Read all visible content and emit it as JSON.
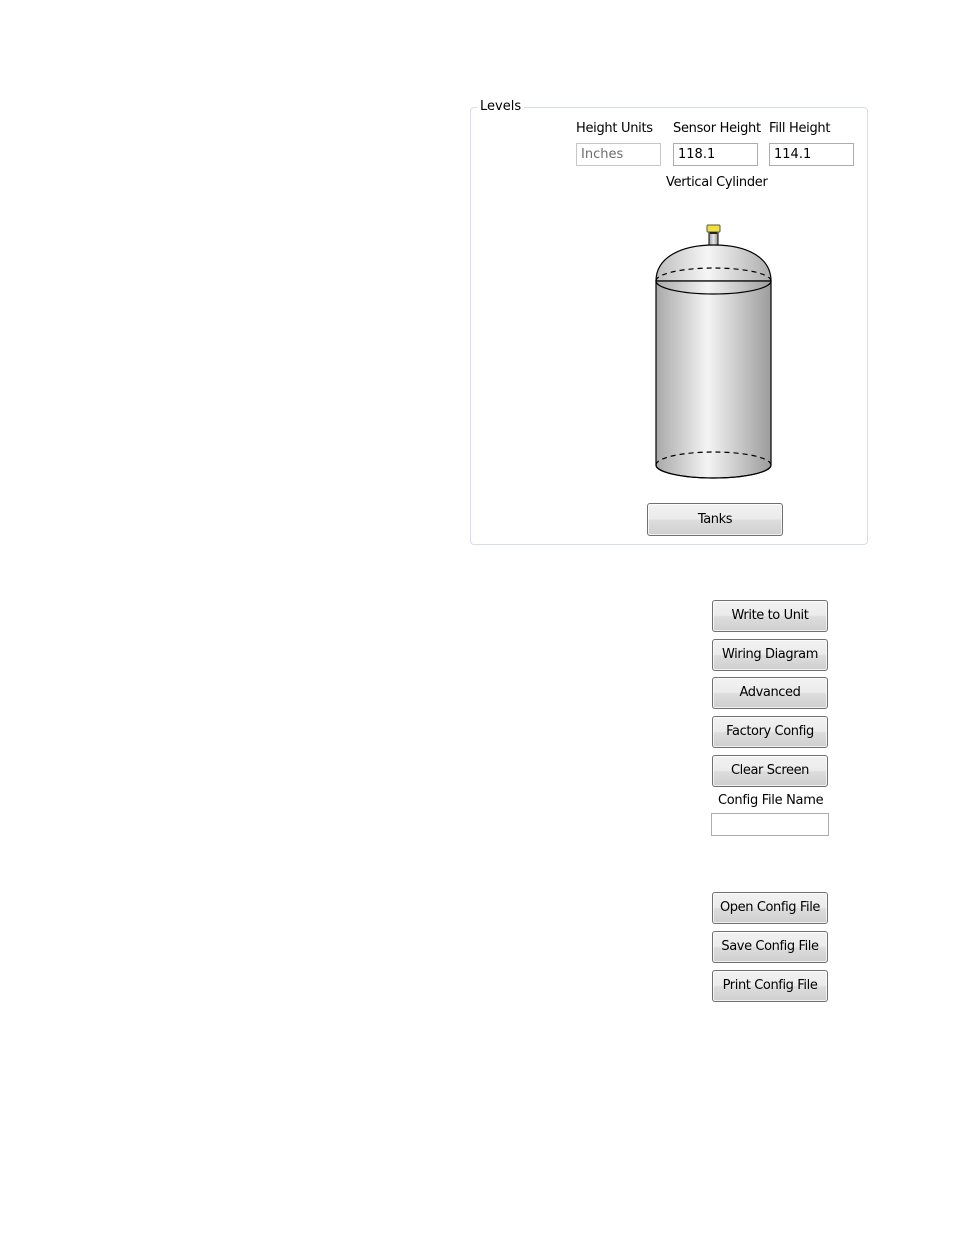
{
  "levels": {
    "group_title": "Levels",
    "height_units_label": "Height Units",
    "height_units_value": "Inches",
    "sensor_height_label": "Sensor Height",
    "sensor_height_value": "118.1",
    "fill_height_label": "Fill Height",
    "fill_height_value": "114.1",
    "tank_type": "Vertical Cylinder",
    "tanks_button": "Tanks"
  },
  "actions": {
    "write_to_unit": "Write to Unit",
    "wiring_diagram": "Wiring Diagram",
    "advanced": "Advanced",
    "factory_config": "Factory Config",
    "clear_screen": "Clear Screen",
    "config_file_name_label": "Config File Name",
    "config_file_name_value": "",
    "open_config_file": "Open Config File",
    "save_config_file": "Save Config File",
    "print_config_file": "Print Config File"
  },
  "colors": {
    "sensor_cap": "#f2e03a",
    "tank_outline": "#000000",
    "tank_body": "#c8c8c8"
  },
  "icons": {
    "tank": "vertical-cylinder-tank-icon",
    "sensor": "level-sensor-icon"
  }
}
